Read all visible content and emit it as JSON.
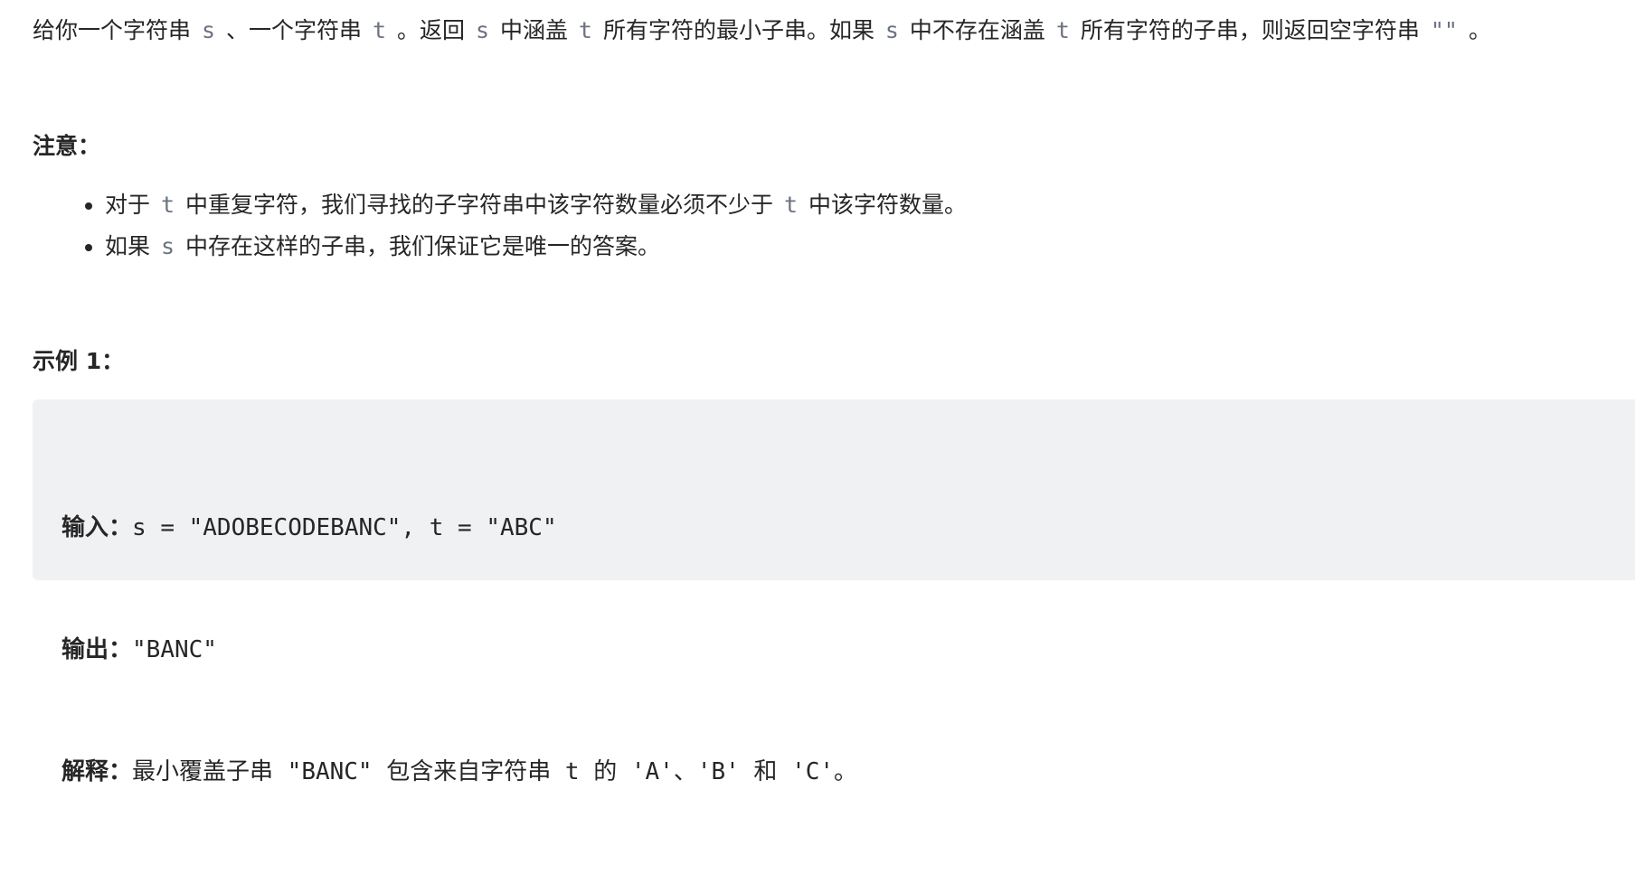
{
  "intro": {
    "p1": "给你一个字符串",
    "s1": "s",
    "p2": "、一个字符串",
    "t1": "t",
    "p3": "。返回",
    "s2": "s",
    "p4": "中涵盖",
    "t2": "t",
    "p5": "所有字符的最小子串。如果",
    "s3": "s",
    "p6": "中不存在涵盖",
    "t3": "t",
    "p7": "所有字符的子串，则返回空字符串",
    "empty": "\"\"",
    "p8": "。"
  },
  "note": {
    "heading": "注意：",
    "item1": {
      "p1": "对于",
      "t": "t",
      "p2": "中重复字符，我们寻找的子字符串中该字符数量必须不少于",
      "t2": "t",
      "p3": "中该字符数量。"
    },
    "item2": {
      "p1": "如果",
      "s": "s",
      "p2": "中存在这样的子串，我们保证它是唯一的答案。"
    }
  },
  "example": {
    "heading": "示例 1：",
    "input_label": "输入：",
    "input_value": "s = \"ADOBECODEBANC\", t = \"ABC\"",
    "output_label": "输出：",
    "output_value": "\"BANC\"",
    "explain_label": "解释：",
    "explain_value": "最小覆盖子串 \"BANC\" 包含来自字符串 t 的 'A'、'B' 和 'C'。"
  }
}
